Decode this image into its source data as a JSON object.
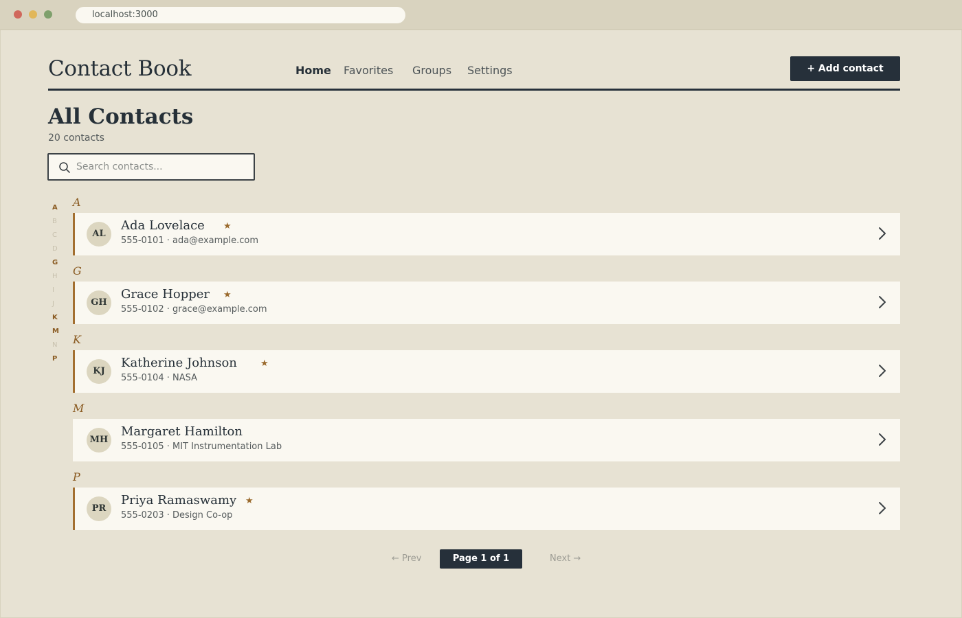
{
  "browser": {
    "url": "localhost:3000"
  },
  "header": {
    "title": "Contact Book",
    "nav": [
      {
        "label": "Home",
        "active": true
      },
      {
        "label": "Favorites",
        "active": false
      },
      {
        "label": "Groups",
        "active": false
      },
      {
        "label": "Settings",
        "active": false
      }
    ],
    "add_button": "+ Add contact"
  },
  "main": {
    "title": "All Contacts",
    "count": "20 contacts",
    "search_placeholder": "Search contacts..."
  },
  "alphabet": [
    {
      "letter": "A",
      "active": true
    },
    {
      "letter": "B",
      "active": false
    },
    {
      "letter": "C",
      "active": false
    },
    {
      "letter": "D",
      "active": false
    },
    {
      "letter": "G",
      "active": true
    },
    {
      "letter": "H",
      "active": false
    },
    {
      "letter": "I",
      "active": false
    },
    {
      "letter": "J",
      "active": false
    },
    {
      "letter": "K",
      "active": true
    },
    {
      "letter": "M",
      "active": true
    },
    {
      "letter": "N",
      "active": false
    },
    {
      "letter": "P",
      "active": true
    }
  ],
  "groups": [
    {
      "letter": "A",
      "contacts": [
        {
          "initials": "AL",
          "name": "Ada Lovelace",
          "favorite": true,
          "detail": "555-0101 · ada@example.com"
        }
      ]
    },
    {
      "letter": "G",
      "contacts": [
        {
          "initials": "GH",
          "name": "Grace Hopper",
          "favorite": true,
          "detail": "555-0102 · grace@example.com"
        }
      ]
    },
    {
      "letter": "K",
      "contacts": [
        {
          "initials": "KJ",
          "name": "Katherine Johnson",
          "favorite": true,
          "detail": "555-0104 · NASA"
        }
      ]
    },
    {
      "letter": "M",
      "contacts": [
        {
          "initials": "MH",
          "name": "Margaret Hamilton",
          "favorite": false,
          "detail": "555-0105 · MIT Instrumentation Lab"
        }
      ]
    },
    {
      "letter": "P",
      "contacts": [
        {
          "initials": "PR",
          "name": "Priya Ramaswamy",
          "favorite": true,
          "detail": "555-0203 · Design Co-op"
        }
      ]
    }
  ],
  "pagination": {
    "prev": "← Prev",
    "indicator": "Page 1 of 1",
    "next": "Next →"
  },
  "icons": {
    "star": "★"
  },
  "colors": {
    "accent": "#a36f30",
    "dark": "#26303a",
    "background": "#e7e2d3",
    "card": "#faf8f1"
  }
}
